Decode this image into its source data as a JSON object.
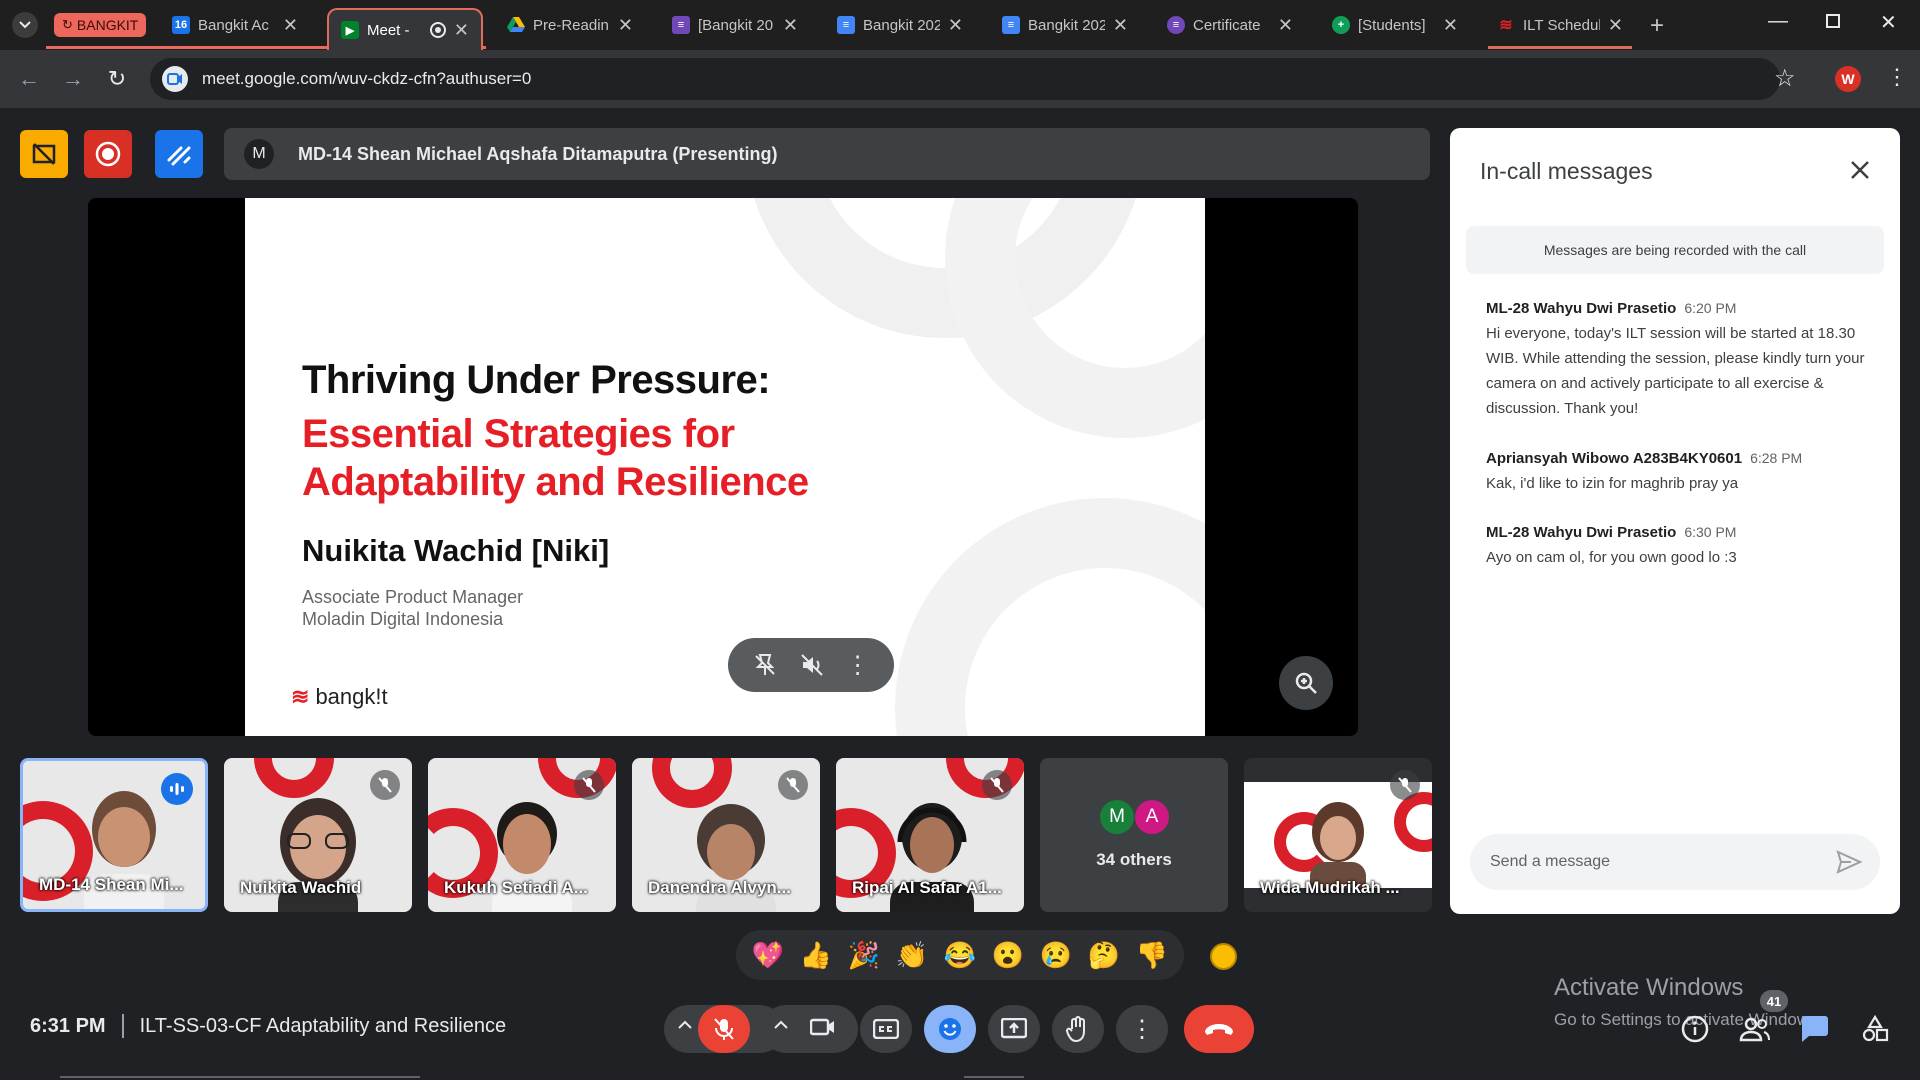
{
  "browser": {
    "tab_group_label": "BANGKIT",
    "tabs": [
      {
        "title": "Bangkit Ac",
        "icon": "calendar-icon",
        "color": "#1a73e8"
      },
      {
        "title": "Meet - ",
        "icon": "meet-icon",
        "color": "#00832d",
        "active": true
      },
      {
        "title": "Pre-Readin",
        "icon": "drive-icon",
        "color": "#fbbc04"
      },
      {
        "title": "[Bangkit 20",
        "icon": "forms-icon",
        "color": "#7248b9"
      },
      {
        "title": "Bangkit 202",
        "icon": "docs-icon",
        "color": "#4285f4"
      },
      {
        "title": "Bangkit 202",
        "icon": "docs-icon",
        "color": "#4285f4"
      },
      {
        "title": "Certificate ",
        "icon": "forms-icon",
        "color": "#7248b9"
      },
      {
        "title": "[Students] ",
        "icon": "sheets-add-icon",
        "color": "#0f9d58"
      },
      {
        "title": "ILT Schedul",
        "icon": "bangkit-icon",
        "color": "#e61f26"
      }
    ],
    "url": "meet.google.com/wuv-ckdz-cfn?authuser=0",
    "profile_initial": "W"
  },
  "meet": {
    "presenter_initial": "M",
    "presenter_label": "MD-14 Shean Michael Aqshafa Ditamaputra (Presenting)",
    "slide": {
      "title_line1": "Thriving Under Pressure:",
      "title_line2": "Essential Strategies for Adaptability and Resilience",
      "speaker": "Nuikita Wachid [Niki]",
      "role_line1": "Associate Product Manager",
      "role_line2": "Moladin Digital Indonesia",
      "brand": "bangk!t"
    },
    "participants": [
      {
        "name": "MD-14 Shean Mi...",
        "speaking": true
      },
      {
        "name": "Nuikita Wachid",
        "muted": true
      },
      {
        "name": "Kukuh Setiadi A...",
        "muted": true
      },
      {
        "name": "Danendra Alvyn...",
        "muted": true
      },
      {
        "name": "Ripai Al Safar A1...",
        "muted": true
      },
      {
        "name": "Wida Mudrikah ...",
        "muted": true
      }
    ],
    "others": {
      "initials": [
        "M",
        "A"
      ],
      "label": "34 others"
    },
    "reactions": [
      "💖",
      "👍",
      "🎉",
      "👏",
      "😂",
      "😮",
      "😢",
      "🤔",
      "👎"
    ],
    "clock": "6:31 PM",
    "meeting_title": "ILT-SS-03-CF Adaptability and Resilience",
    "participant_count": "41"
  },
  "chat": {
    "title": "In-call messages",
    "notice": "Messages are being recorded with the call",
    "messages": [
      {
        "sender": "ML-28 Wahyu Dwi Prasetio",
        "time": "6:20 PM",
        "text": "Hi everyone, today's ILT session will be started at 18.30 WIB. While attending the session, please kindly turn your camera on and actively participate to all exercise & discussion. Thank you!"
      },
      {
        "sender": "Apriansyah Wibowo A283B4KY0601",
        "time": "6:28 PM",
        "text": "Kak, i'd like to izin for maghrib pray ya"
      },
      {
        "sender": "ML-28 Wahyu Dwi Prasetio",
        "time": "6:30 PM",
        "text": "Ayo on cam ol, for you own good lo :3"
      }
    ],
    "input_placeholder": "Send a message"
  },
  "windows": {
    "activate_title": "Activate Windows",
    "activate_sub": "Go to Settings to activate Windows."
  }
}
